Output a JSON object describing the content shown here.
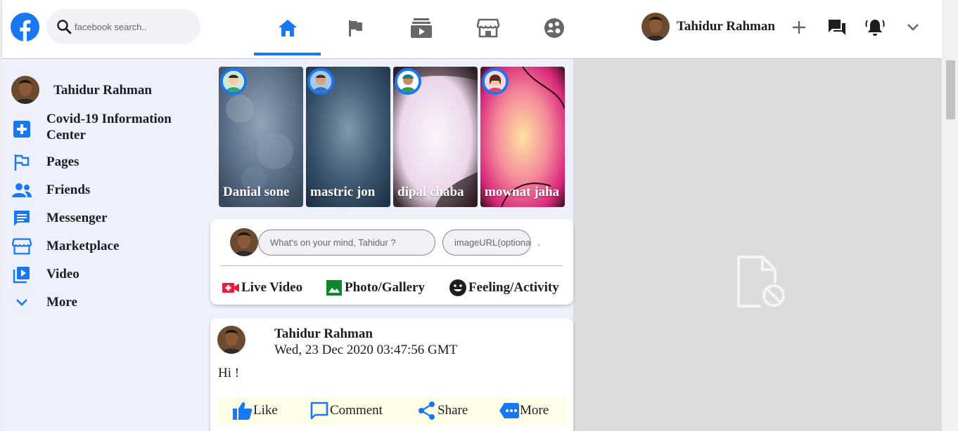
{
  "header": {
    "search_placeholder": "facebook search..",
    "user_name": "Tahidur Rahman",
    "nav_tabs": [
      "home",
      "pages",
      "watch",
      "marketplace",
      "groups"
    ],
    "active_tab": "home",
    "accent": "#1877f2"
  },
  "sidebar": {
    "profile_name": "Tahidur Rahman",
    "items": [
      {
        "label": "Covid-19 Information",
        "label2": "Center",
        "icon": "plus-box-icon"
      },
      {
        "label": "Pages",
        "icon": "flag-outline-icon"
      },
      {
        "label": "Friends",
        "icon": "friends-icon"
      },
      {
        "label": "Messenger",
        "icon": "message-icon"
      },
      {
        "label": "Marketplace",
        "icon": "store-icon"
      },
      {
        "label": "Video",
        "icon": "video-library-icon"
      },
      {
        "label": "More",
        "icon": "chevron-down-icon"
      }
    ]
  },
  "stories": [
    {
      "name": "Danial sone"
    },
    {
      "name": "mastric jon"
    },
    {
      "name": "dipal chaba"
    },
    {
      "name": "mownat jaha"
    }
  ],
  "composer": {
    "placeholder": "What's on your mind, Tahidur ?",
    "url_placeholder": "imageURL(optional)",
    "actions": [
      "Live Video",
      "Photo/Gallery",
      "Feeling/Activity"
    ]
  },
  "post": {
    "author": "Tahidur Rahman",
    "timestamp": "Wed, 23 Dec 2020 03:47:56 GMT",
    "text": "Hi !",
    "actions": [
      "Like",
      "Comment",
      "Share",
      "More"
    ]
  }
}
